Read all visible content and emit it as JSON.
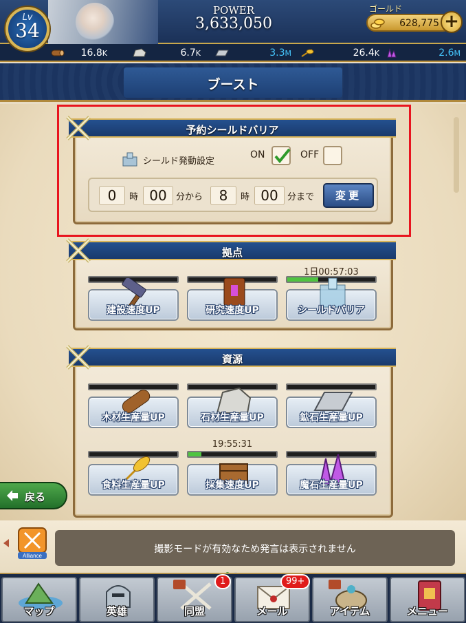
{
  "header": {
    "level_label": "Lv",
    "level": "34",
    "power_label": "POWER",
    "power_value": "3,633,050",
    "gold_label": "ゴールド",
    "gold_value": "628,775",
    "plus_label": "+"
  },
  "resources": [
    {
      "icon": "wood-log-icon",
      "value": "16.8",
      "unit": "K",
      "color": "#ffffff"
    },
    {
      "icon": "stone-icon",
      "value": "6.7",
      "unit": "K",
      "color": "#ffffff"
    },
    {
      "icon": "ore-ingot-icon",
      "value": "3.3",
      "unit": "M",
      "color": "#46c8ff"
    },
    {
      "icon": "food-wheat-icon",
      "value": "26.4",
      "unit": "K",
      "color": "#ffffff"
    },
    {
      "icon": "magic-crystal-icon",
      "value": "2.6",
      "unit": "M",
      "color": "#46c8ff"
    }
  ],
  "page_title": "ブースト",
  "shield_panel": {
    "title": "予約シールドバリア",
    "setting_label": "シールド発動設定",
    "on_label": "ON",
    "off_label": "OFF",
    "on_checked": true,
    "off_checked": false,
    "start_hour": "0",
    "hour_unit": "時",
    "start_min": "00",
    "from_unit": "分から",
    "end_hour": "8",
    "end_min": "00",
    "until_unit": "分まで",
    "change_label": "変更"
  },
  "base_panel": {
    "title": "拠点",
    "buttons": [
      {
        "label": "建設速度UP",
        "icon": "hammer-icon",
        "progress": 0,
        "timer": ""
      },
      {
        "label": "研究速度UP",
        "icon": "book-icon",
        "progress": 0,
        "timer": ""
      },
      {
        "label": "シールドバリア",
        "icon": "shield-castle-icon",
        "progress": 0.35,
        "timer": "1日00:57:03"
      }
    ]
  },
  "resource_panel": {
    "title": "資源",
    "buttons": [
      {
        "label": "木材生産量UP",
        "icon": "wood-log-icon",
        "progress": 0,
        "timer": ""
      },
      {
        "label": "石材生産量UP",
        "icon": "stone-icon",
        "progress": 0,
        "timer": ""
      },
      {
        "label": "鉱石生産量UP",
        "icon": "ore-ingot-icon",
        "progress": 0,
        "timer": ""
      },
      {
        "label": "食料生産量UP",
        "icon": "food-wheat-icon",
        "progress": 0,
        "timer": ""
      },
      {
        "label": "採集速度UP",
        "icon": "gather-crate-icon",
        "progress": 0.15,
        "timer": "19:55:31"
      },
      {
        "label": "魔石生産量UP",
        "icon": "magic-crystal-icon",
        "progress": 0,
        "timer": ""
      }
    ]
  },
  "back_label": "戻る",
  "chat": {
    "alliance_label": "Alliance",
    "message": "撮影モードが有効なため発言は表示されません"
  },
  "nav": [
    {
      "label": "マップ",
      "icon": "map-icon",
      "badge": ""
    },
    {
      "label": "英雄",
      "icon": "hero-helmet-icon",
      "badge": ""
    },
    {
      "label": "同盟",
      "icon": "alliance-swords-icon",
      "badge": "1"
    },
    {
      "label": "メール",
      "icon": "mail-icon",
      "badge": "99+"
    },
    {
      "label": "アイテム",
      "icon": "item-bag-icon",
      "badge": ""
    },
    {
      "label": "メニュー",
      "icon": "menu-book-icon",
      "badge": ""
    }
  ],
  "colors": {
    "accent_blue": "#1d3f74",
    "gold": "#d6a631",
    "highlight_red": "#e8141e",
    "progress_green": "#4fc440"
  }
}
